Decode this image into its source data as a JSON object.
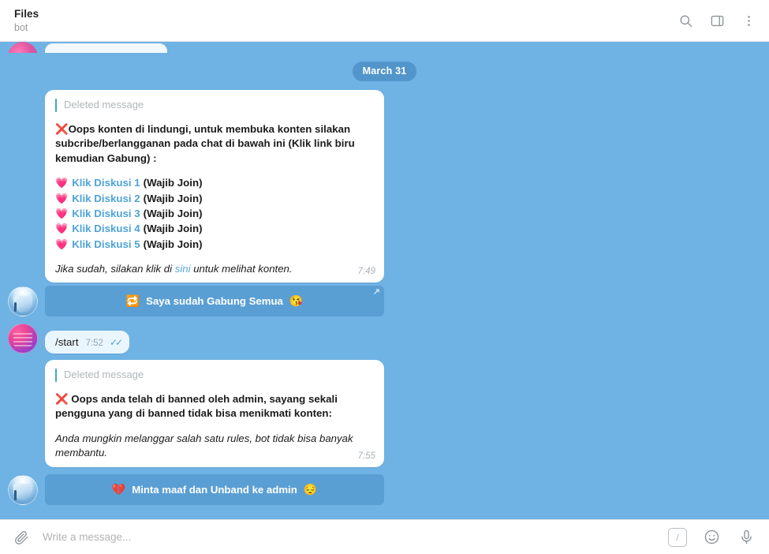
{
  "header": {
    "title": "Files",
    "subtitle": "bot",
    "icons": {
      "search": "search-icon",
      "panel": "sidebar-panel-icon",
      "menu": "more-vertical-icon"
    }
  },
  "chat": {
    "date_divider": "March 31",
    "messages": [
      {
        "id": "msg-protected-content",
        "reply_label": "Deleted message",
        "bold_text_prefix": "❌",
        "bold_text": "Oops konten di lindungi, untuk membuka konten silakan subcribe/berlangganan pada chat di bawah ini (Klik link biru kemudian Gabung) :",
        "links": [
          {
            "emoji": "💗",
            "label": "Klik Diskusi 1",
            "suffix": "(Wajib Join)"
          },
          {
            "emoji": "💗",
            "label": "Klik Diskusi 2",
            "suffix": "(Wajib Join)"
          },
          {
            "emoji": "💗",
            "label": "Klik Diskusi 3",
            "suffix": "(Wajib Join)"
          },
          {
            "emoji": "💗",
            "label": "Klik Diskusi 4",
            "suffix": "(Wajib Join)"
          },
          {
            "emoji": "💗",
            "label": "Klik Diskusi 5",
            "suffix": "(Wajib Join)"
          }
        ],
        "footer_italic_before": "Jika sudah, silakan klik di ",
        "footer_italic_link": "sini",
        "footer_italic_after": " untuk melihat konten.",
        "time": "7:49"
      },
      {
        "id": "msg-banned",
        "reply_label": "Deleted message",
        "bold_text_prefix": "❌",
        "bold_text": "Oops anda telah di banned oleh admin, sayang sekali pengguna yang di banned tidak bisa menikmati konten:",
        "italic_text": "Anda mungkin melanggar salah satu rules, bot tidak bisa banyak membantu.",
        "time": "7:55"
      }
    ],
    "buttons": [
      {
        "id": "btn-gabung-semua",
        "icon_emoji": "🔁",
        "label": "Saya sudah Gabung Semua",
        "trailing_emoji": "😘",
        "external_arrow": "↗"
      },
      {
        "id": "btn-minta-maaf",
        "icon_emoji": "💔",
        "label": "Minta maaf dan Unband ke admin",
        "trailing_emoji": "😔",
        "external_arrow": ""
      }
    ],
    "outgoing": {
      "text": "/start",
      "time": "7:52",
      "read_marks": "✓✓"
    }
  },
  "composer": {
    "placeholder": "Write a message...",
    "value": "",
    "attach_icon": "paperclip-icon",
    "command_icon": "/",
    "emoji_icon": "smiley-icon",
    "mic_icon": "microphone-icon"
  },
  "colors": {
    "chat_background": "#6fb2e4",
    "bubble_incoming": "#ffffff",
    "bubble_outgoing": "#eaf6fd",
    "keyboard_button": "#5a9fd4",
    "link_blue": "#4ea3d8",
    "reply_bar": "#42a6b8",
    "date_pill": "rgba(42,110,170,0.42)"
  }
}
